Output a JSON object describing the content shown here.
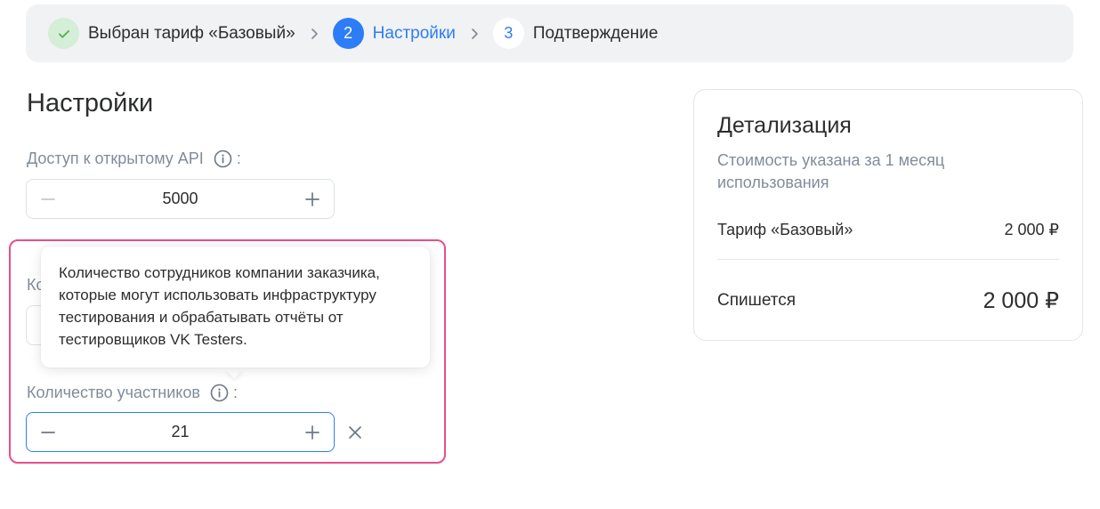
{
  "stepper": {
    "steps": [
      {
        "number": "",
        "label": "Выбран тариф «Базовый»",
        "state": "done"
      },
      {
        "number": "2",
        "label": "Настройки",
        "state": "active"
      },
      {
        "number": "3",
        "label": "Подтверждение",
        "state": "todo"
      }
    ]
  },
  "settings": {
    "title": "Настройки",
    "api": {
      "label": "Доступ к открытому API",
      "colon": ":",
      "value": "5000"
    },
    "hidden_field": {
      "label_fragment": "Ко"
    },
    "tooltip": {
      "text": "Количество сотрудников компании заказчика, которые могут использовать инфраструктуру тестирования и обрабатывать отчёты от тестировщиков VK Testers."
    },
    "participants": {
      "label": "Количество участников",
      "colon": ":",
      "value": "21"
    }
  },
  "details": {
    "title": "Детализация",
    "subtitle": "Стоимость указана за 1 месяц использования",
    "tariff_label": "Тариф «Базовый»",
    "tariff_price": "2 000 ₽",
    "total_label": "Спишется",
    "total_price": "2 000 ₽"
  },
  "colors": {
    "accent": "#2c7df7",
    "done_bg": "#d4eed7",
    "done_check": "#4bb34b",
    "highlight": "#e94e8c",
    "muted": "#818c99"
  },
  "icons": {
    "done": "check-icon",
    "separator": "chevron-right-icon",
    "info": "info-icon",
    "decrement": "minus-icon",
    "increment": "plus-icon",
    "clear": "close-icon"
  }
}
